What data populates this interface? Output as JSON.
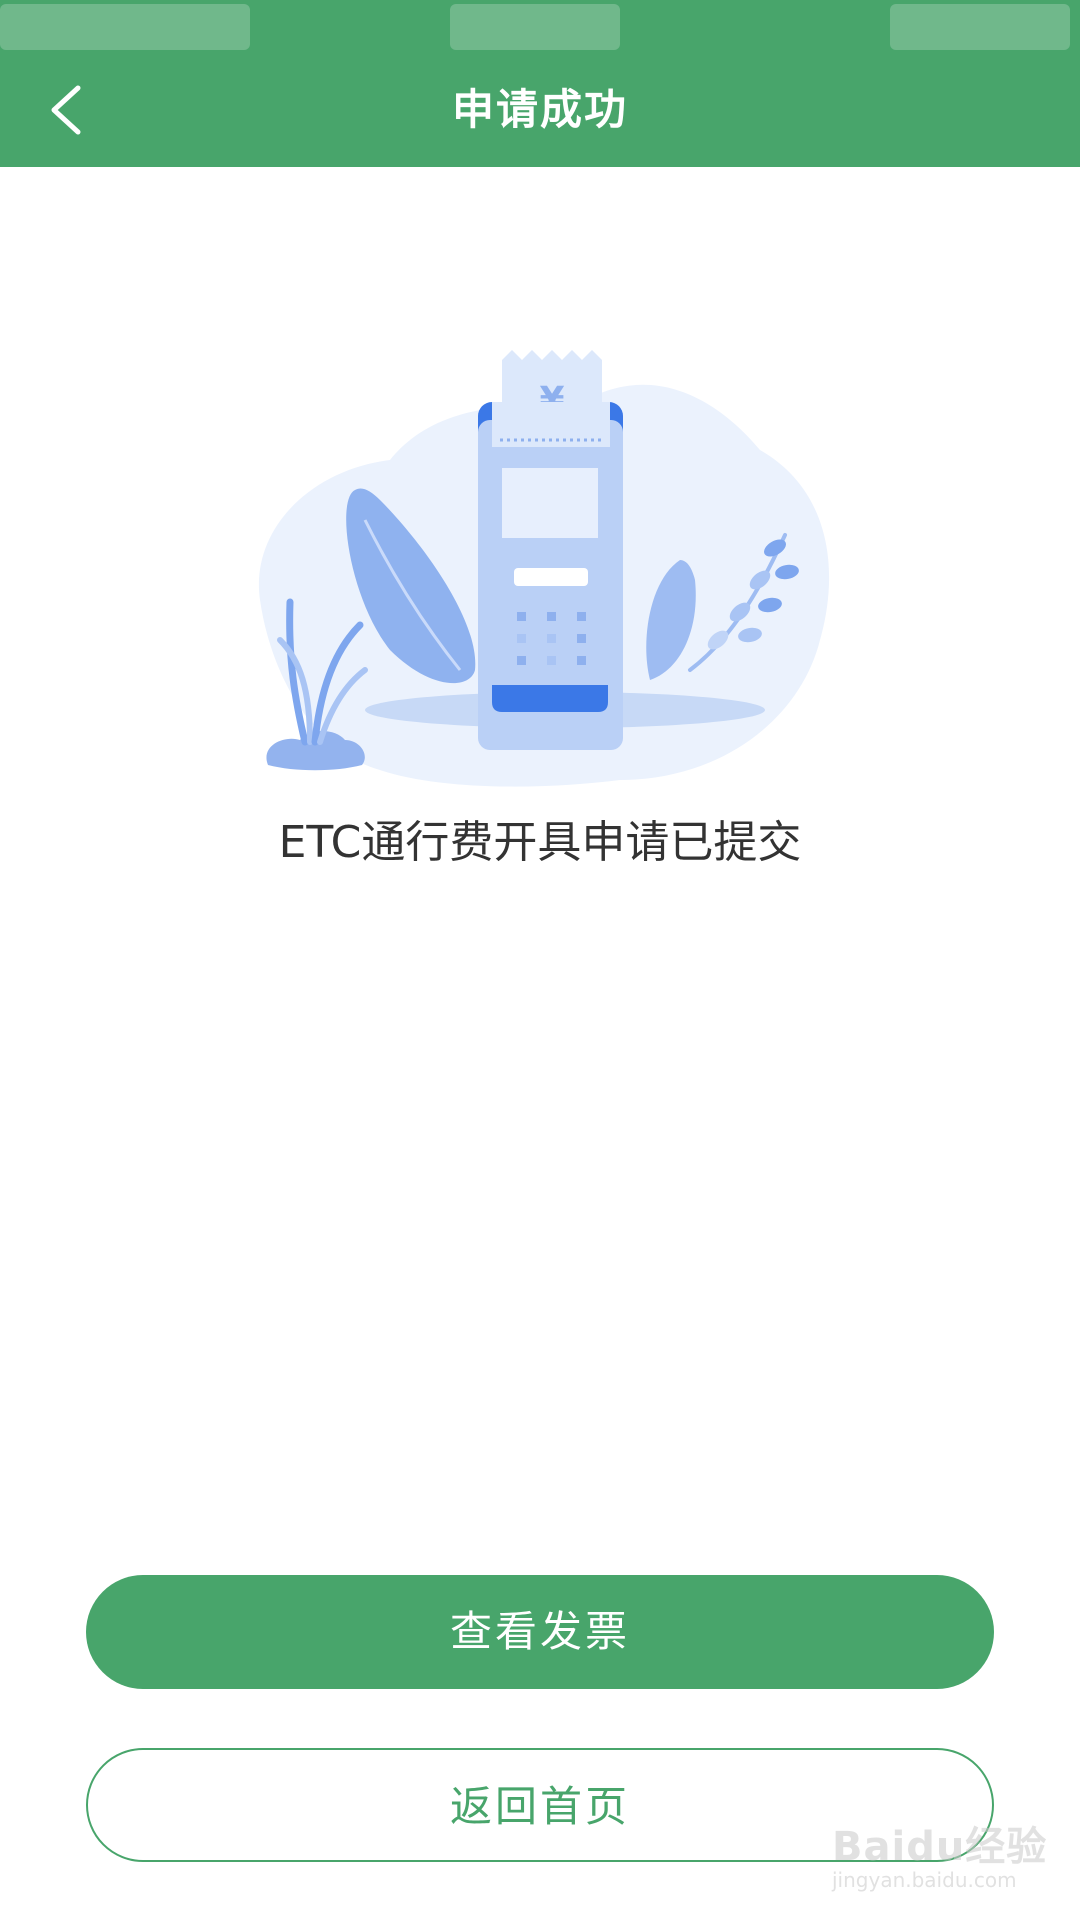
{
  "header": {
    "title": "申请成功",
    "back_icon": "chevron-left-icon",
    "background_color": "#48a56b"
  },
  "illustration": {
    "icon": "receipt-terminal-illustration",
    "currency_symbol": "¥"
  },
  "message": "ETC通行费开具申请已提交",
  "buttons": {
    "primary_label": "查看发票",
    "secondary_label": "返回首页"
  },
  "watermark": {
    "brand": "Baidu经验",
    "url": "jingyan.baidu.com"
  },
  "colors": {
    "accent": "#48a56b",
    "text": "#333333",
    "illustration_blue": "#3b78e7"
  }
}
